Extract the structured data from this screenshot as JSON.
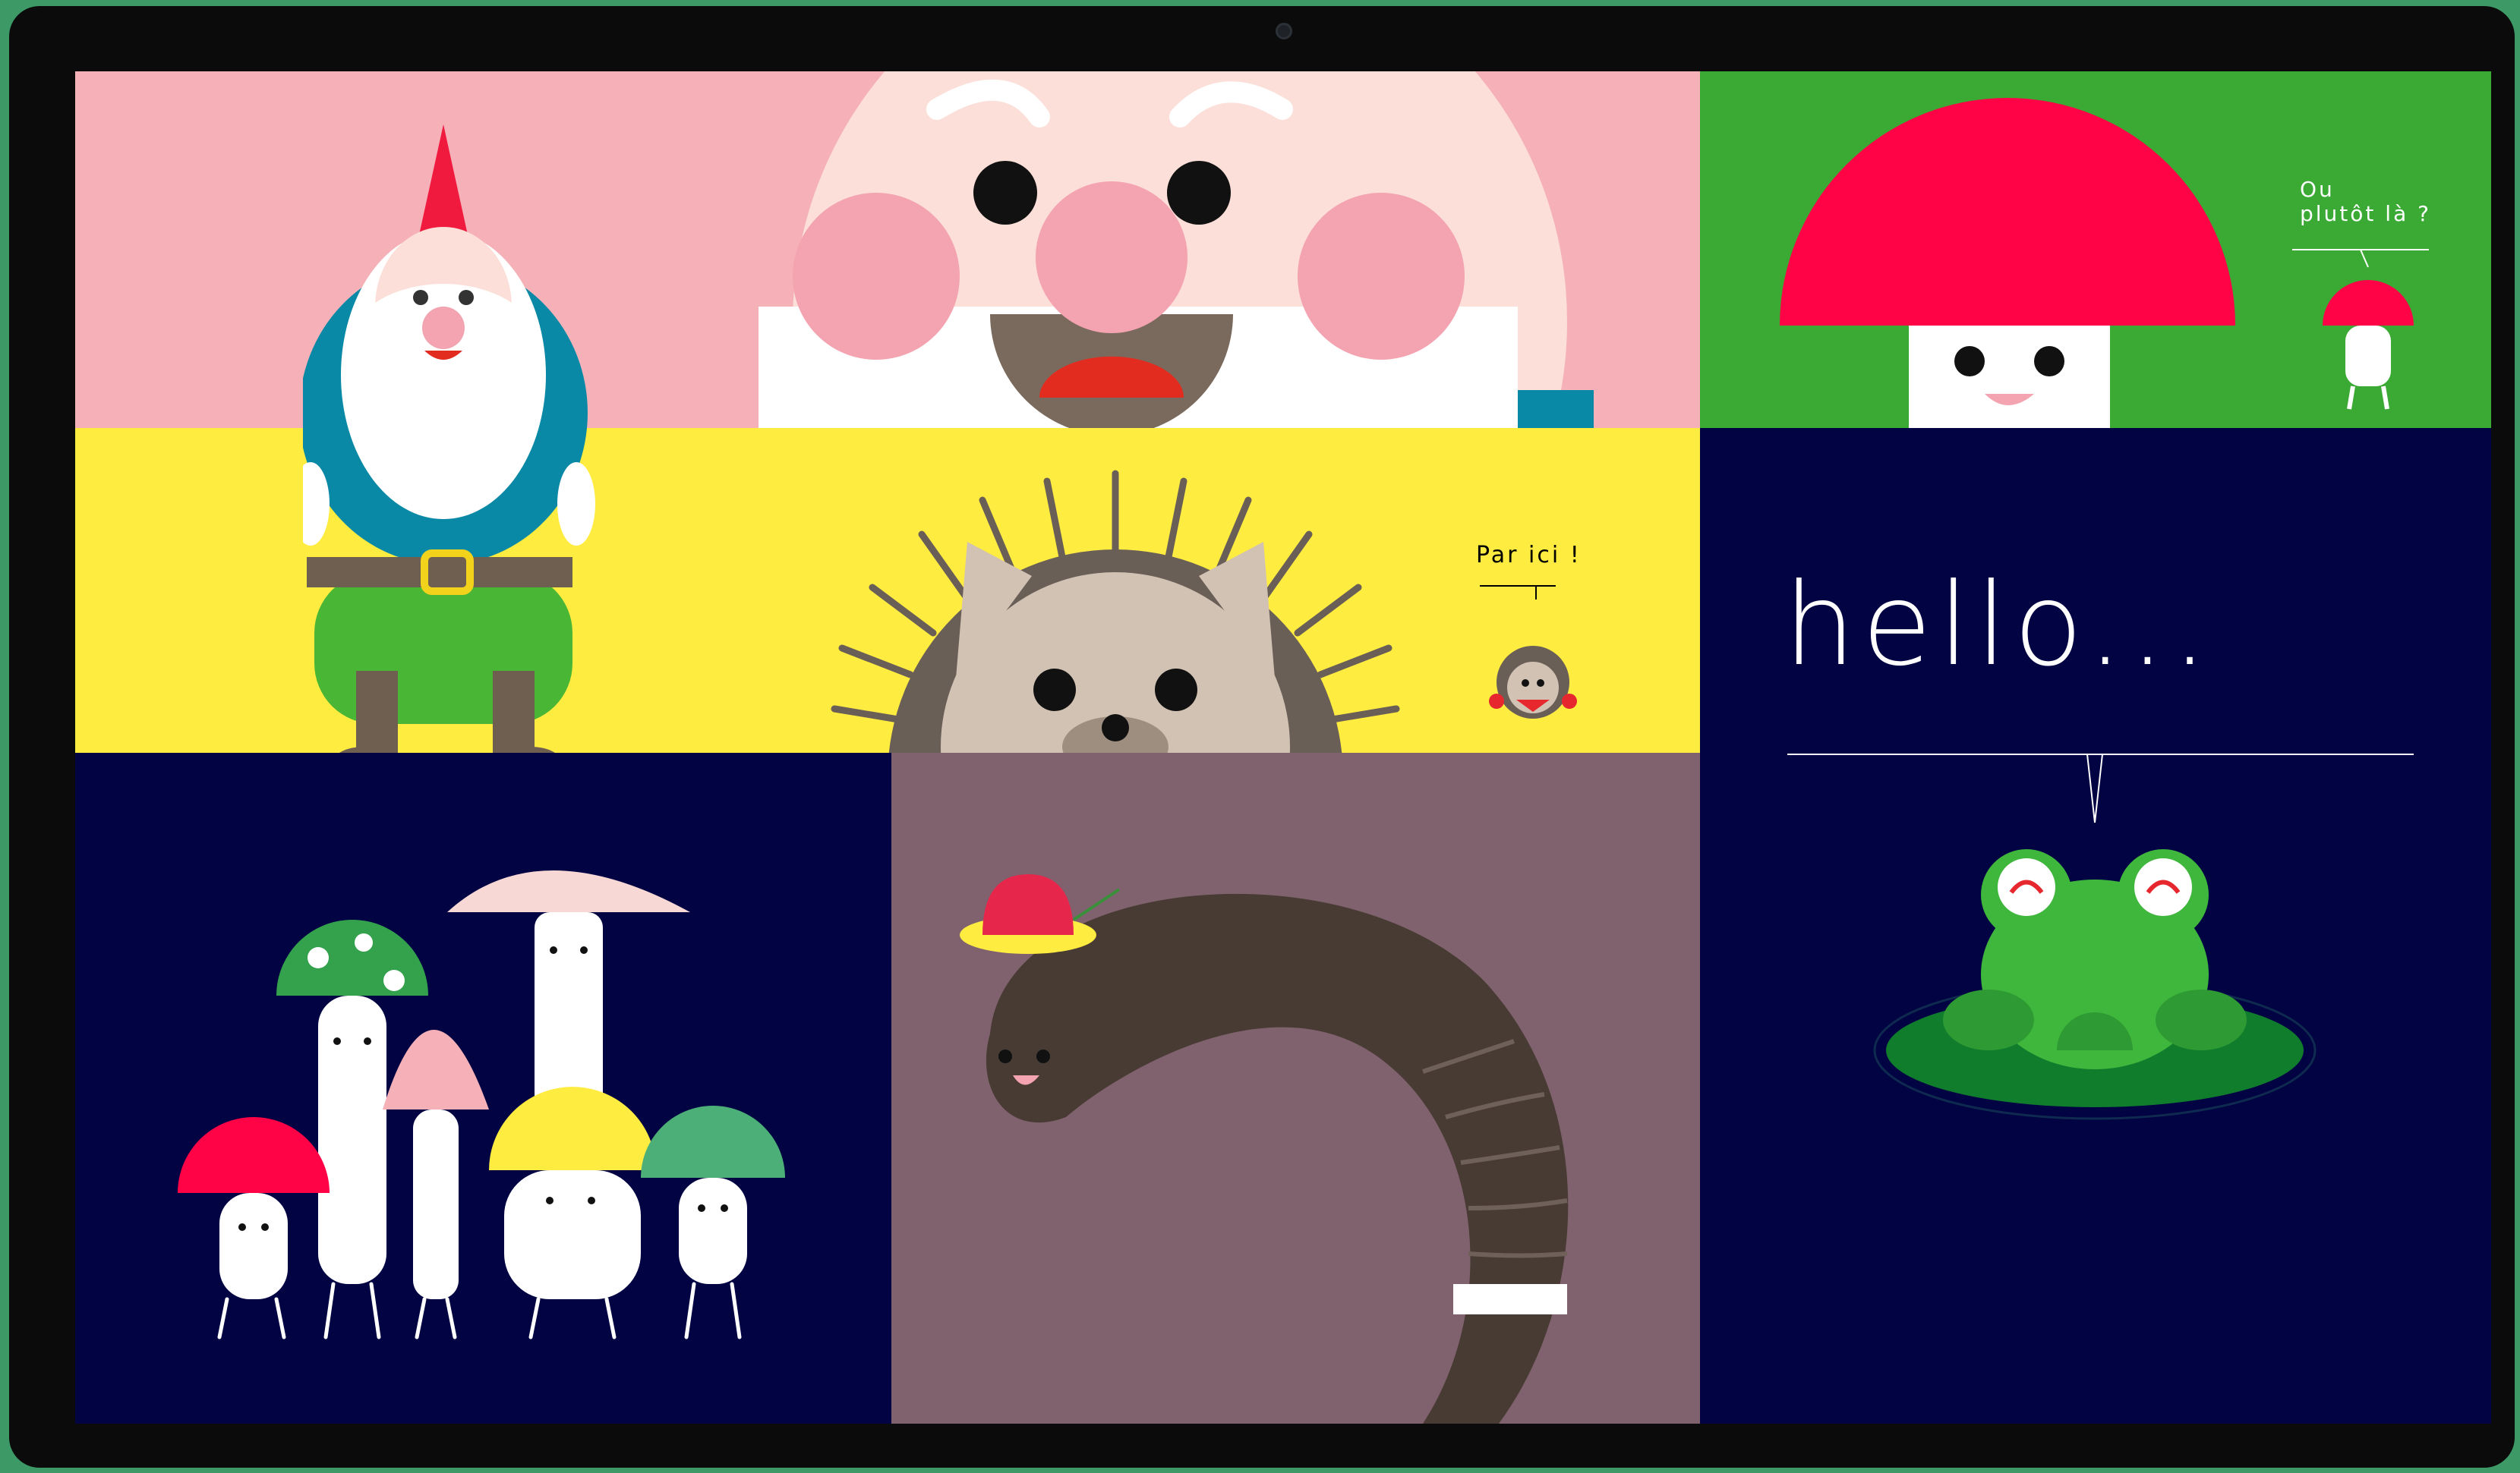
{
  "colors": {
    "pink": "#f5b1b7",
    "green": "#3aaa35",
    "yellow": "#ffec40",
    "navy": "#010343",
    "mauve": "#80626f",
    "gnome_hat": "#f0193e",
    "gnome_coat": "#0a89a6",
    "gnome_pants": "#4ab635",
    "mushroom_red": "#ff0346",
    "frog_green": "#3fb63c",
    "worm_brown": "#483b33"
  },
  "gnome_tile": {
    "character": "gnome"
  },
  "mushroom_tile": {
    "character": "mushroom",
    "speech": "Ou\nplutôt là ?"
  },
  "hedgehog_tile": {
    "character": "hedgehog",
    "speech": "Par ici !"
  },
  "frog_tile": {
    "character": "frog",
    "greeting": "hello..."
  },
  "mushrooms_tile": {
    "character": "mushroom-family"
  },
  "worm_tile": {
    "character": "worm-with-hat"
  }
}
